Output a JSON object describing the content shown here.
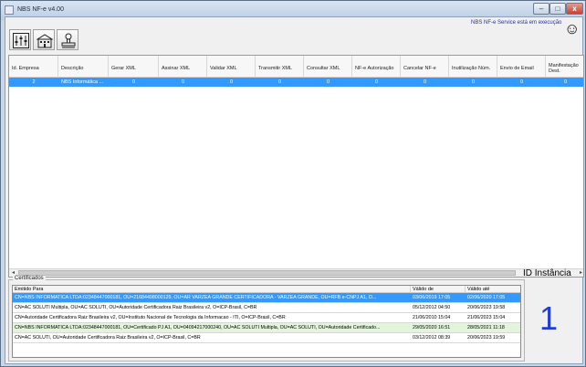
{
  "window": {
    "title": "NBS NF-e v4.00",
    "min_label": "–",
    "max_label": "□",
    "close_label": "x"
  },
  "status": {
    "service_text": "NBS NF-e Service está em execução",
    "smiley": "☺"
  },
  "toolbar": {
    "buttons": [
      "settings-sliders-icon",
      "building-icon",
      "stamp-icon"
    ]
  },
  "grid": {
    "columns": [
      "Id. Empresa",
      "Descrição",
      "Gerar XML",
      "Assinar XML",
      "Validar XML",
      "Transmitir XML",
      "Consultar XML",
      "NF-e Autorização",
      "Cancelar NF-e",
      "Inutilização Núm.",
      "Envio de Email",
      "Manifestação Dest."
    ],
    "rows": [
      {
        "id": "2",
        "descricao": "NBS Informática ...",
        "values": [
          "0",
          "0",
          "0",
          "0",
          "0",
          "0",
          "0",
          "0",
          "0",
          "0"
        ]
      }
    ],
    "scroll_left": "◂",
    "scroll_right": "▸"
  },
  "certificados": {
    "legend": "Certificados",
    "columns": [
      "Emitido Para",
      "Válido de",
      "Válido até"
    ],
    "rows": [
      {
        "emitido": "CN=NBS INFORMATICA LTDA:02348447000181, OU=21684498000129, OU=AR VARZEA GRANDE CERTIFICADORA - VARZEA GRANDE, OU=RFB e-CNPJ A1, O...",
        "de": "03/06/2019 17:05",
        "ate": "02/06/2020 17:05",
        "style": "sel"
      },
      {
        "emitido": "CN=AC SOLUTI Multipla, OU=AC SOLUTI, OU=Autoridade Certificadora Raiz Brasileira v2, O=ICP-Brasil, C=BR",
        "de": "05/12/2012 04:50",
        "ate": "20/06/2023 19:58",
        "style": "white"
      },
      {
        "emitido": "CN=Autoridade Certificadora Raiz Brasileira v2, OU=Instituto Nacional de Tecnologia da Informacao - ITI, O=ICP-Brasil, C=BR",
        "de": "21/06/2010 15:04",
        "ate": "21/06/2023 15:04",
        "style": "white"
      },
      {
        "emitido": "CN=NBS INFORMATICA LTDA:02348447000181, OU=Certificado PJ A1, OU=04094217000240, OU=AC SOLUTI Multipla, OU=AC SOLUTI, OU=Autoridade Certificado...",
        "de": "29/05/2020 16:51",
        "ate": "28/05/2021 11:18",
        "style": "green"
      },
      {
        "emitido": "CN=AC SOLUTI, OU=Autoridade Certificadora Raiz Brasileira v2, O=ICP-Brasil, C=BR",
        "de": "03/12/2012 08:39",
        "ate": "20/06/2023 19:59",
        "style": "white"
      }
    ]
  },
  "instancia": {
    "label": "ID Instância",
    "value": "1"
  }
}
